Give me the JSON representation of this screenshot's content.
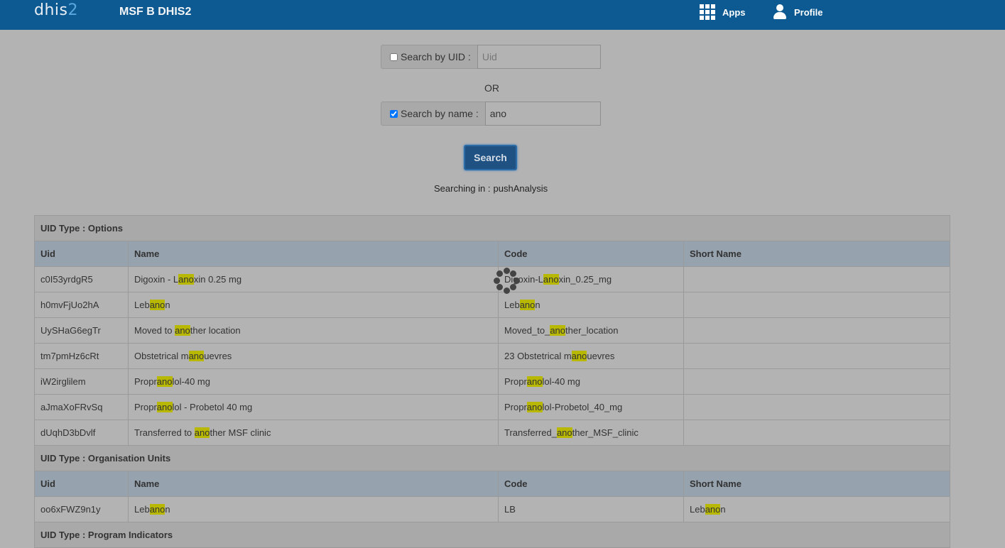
{
  "header": {
    "logo_main": "dhis",
    "logo_suffix": "2",
    "title": "MSF B DHIS2",
    "apps_label": "Apps",
    "profile_label": "Profile"
  },
  "search": {
    "uid_label": "Search by UID :",
    "uid_checked": false,
    "uid_value": "",
    "uid_placeholder": "Uid",
    "or_label": "OR",
    "name_label": "Search by name :",
    "name_checked": true,
    "name_value": "ano",
    "button_label": "Search",
    "searching_in_label": "Searching in :",
    "searching_in_value": "pushAnalysis"
  },
  "highlight": "ano",
  "columns": [
    "Uid",
    "Name",
    "Code",
    "Short Name"
  ],
  "sections": [
    {
      "title": "UID Type : Options",
      "rows": [
        {
          "uid": "c0I53yrdgR5",
          "name": "Digoxin - Lanoxin 0.25 mg",
          "code": "Digoxin-Lanoxin_0.25_mg",
          "short_name": ""
        },
        {
          "uid": "h0mvFjUo2hA",
          "name": "Lebanon",
          "code": "Lebanon",
          "short_name": ""
        },
        {
          "uid": "UySHaG6egTr",
          "name": "Moved to another location",
          "code": "Moved_to_another_location",
          "short_name": ""
        },
        {
          "uid": "tm7pmHz6cRt",
          "name": "Obstetrical manouevres",
          "code": "23 Obstetrical manouevres",
          "short_name": ""
        },
        {
          "uid": "iW2irglilem",
          "name": "Propranolol-40 mg",
          "code": "Propranolol-40 mg",
          "short_name": ""
        },
        {
          "uid": "aJmaXoFRvSq",
          "name": "Propranolol - Probetol 40 mg",
          "code": "Propranolol-Probetol_40_mg",
          "short_name": ""
        },
        {
          "uid": "dUqhD3bDvlf",
          "name": "Transferred to another MSF clinic",
          "code": "Transferred_another_MSF_clinic",
          "short_name": ""
        }
      ]
    },
    {
      "title": "UID Type : Organisation Units",
      "rows": [
        {
          "uid": "oo6xFWZ9n1y",
          "name": "Lebanon",
          "code": "LB",
          "short_name": "Lebanon"
        }
      ]
    },
    {
      "title": "UID Type : Program Indicators",
      "rows": []
    }
  ],
  "colors": {
    "topbar": "#0d5a93",
    "highlight": "#b8b800",
    "overlay_bg": "#b3b3b3",
    "search_button": "#1f5283"
  },
  "icons": {
    "apps": "grid-icon",
    "profile": "person-icon",
    "loading": "spinner-icon"
  }
}
